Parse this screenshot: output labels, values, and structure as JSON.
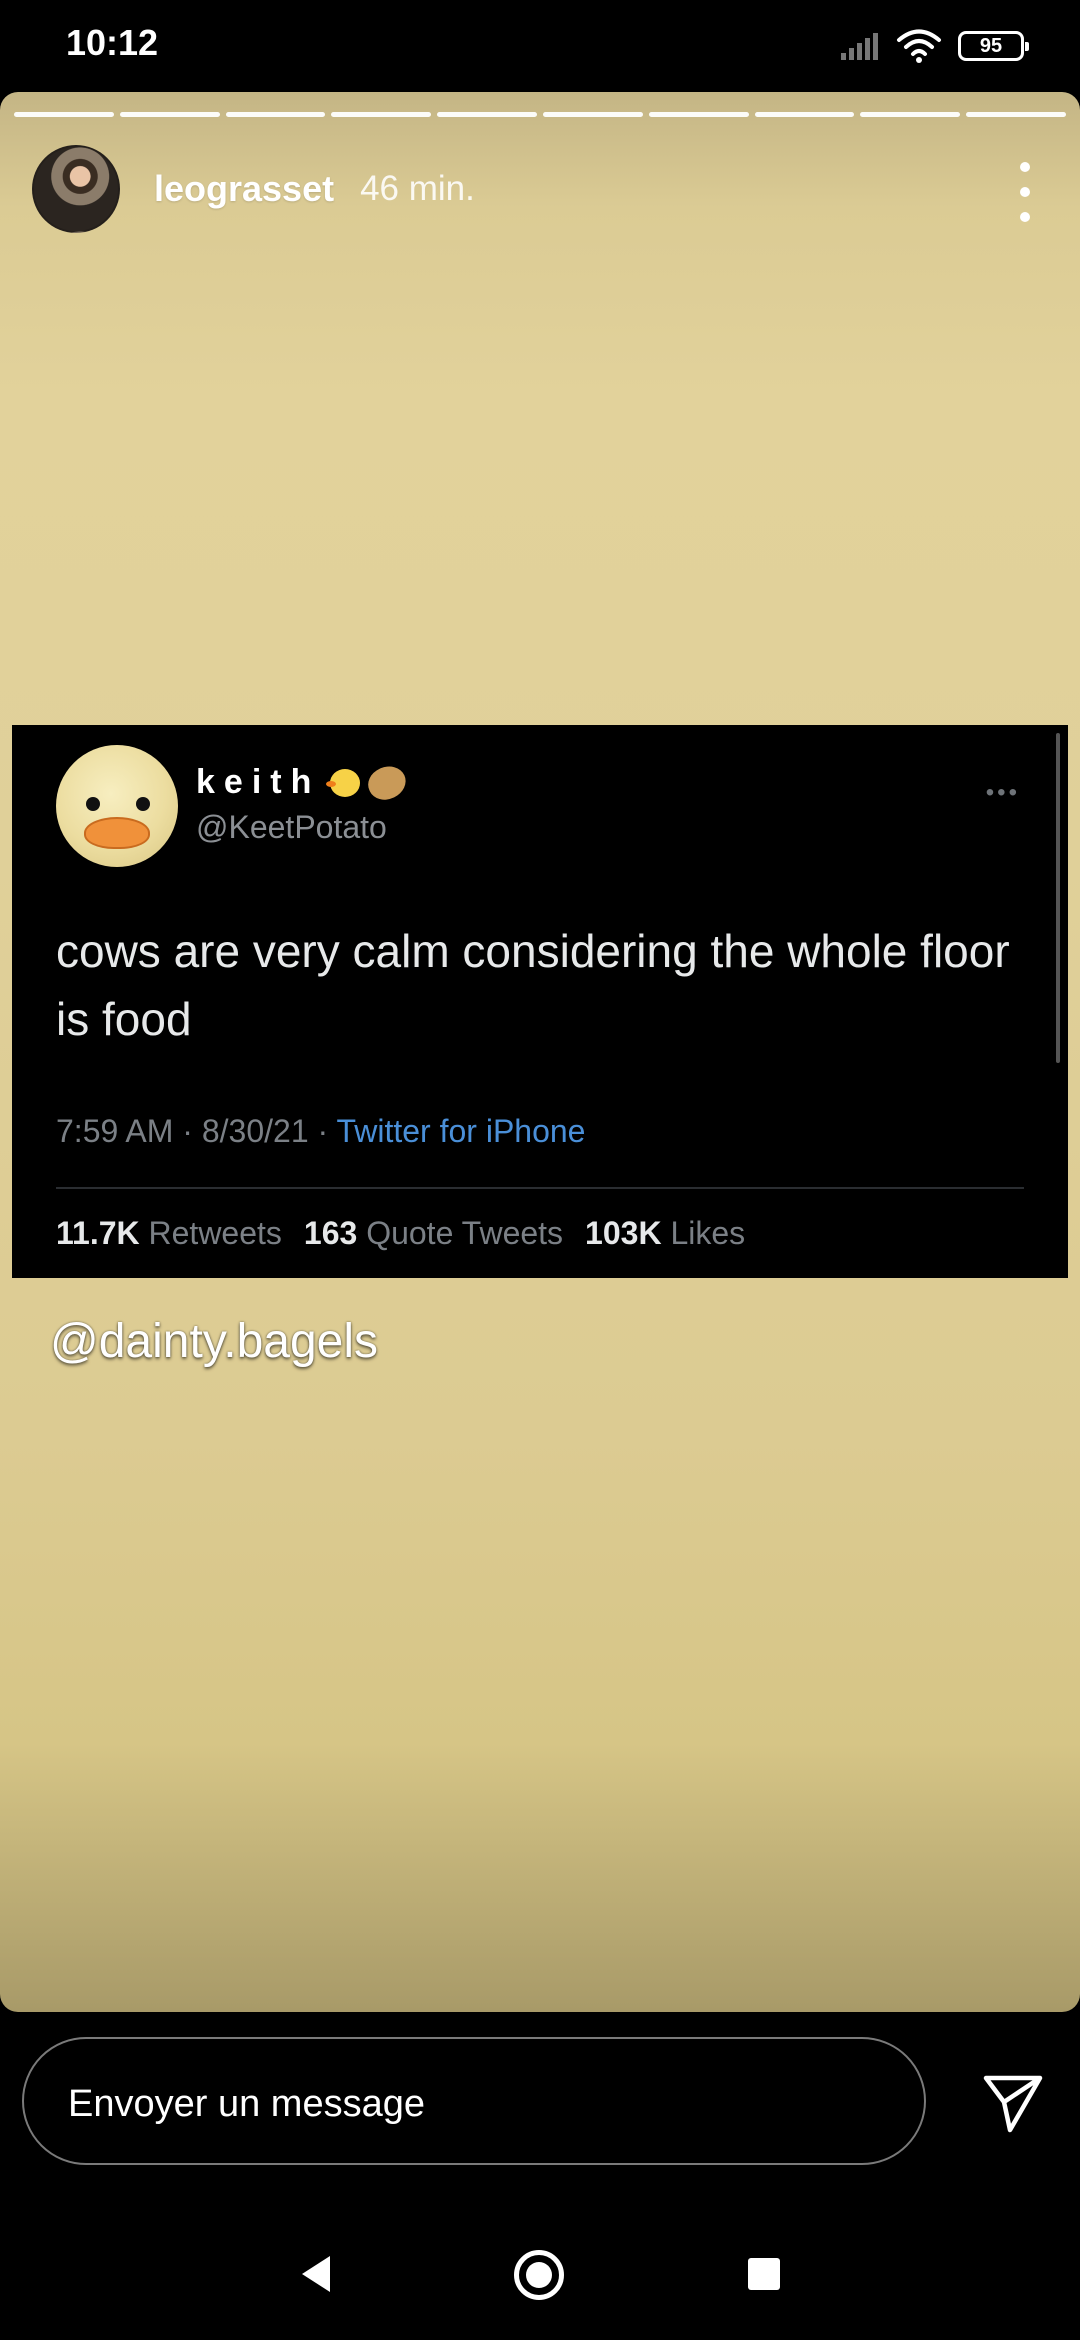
{
  "status_bar": {
    "time": "10:12",
    "battery": "95",
    "icons": [
      "signal-icon",
      "wifi-icon",
      "battery-icon"
    ]
  },
  "story": {
    "progress": {
      "segments": 10,
      "current": 10
    },
    "username": "leograsset",
    "time_ago": "46 min.",
    "more_icon": "vertical-dots-icon",
    "background_color": "#e0d099",
    "tweet": {
      "display_name": "keith",
      "name_emojis": [
        "chick-emoji",
        "potato-emoji"
      ],
      "handle": "@KeetPotato",
      "text": "cows are very calm considering the whole floor is food",
      "time": "7:59 AM",
      "date": "8/30/21",
      "source": "Twitter for iPhone",
      "retweets_count": "11.7K",
      "retweets_label": "Retweets",
      "quotes_count": "163",
      "quotes_label": "Quote Tweets",
      "likes_count": "103K",
      "likes_label": "Likes",
      "link_color": "#4a8fd8"
    },
    "mention": "@dainty.bagels"
  },
  "reply": {
    "placeholder": "Envoyer un message",
    "send_icon": "paper-plane-icon"
  },
  "nav_bar": {
    "icons": [
      "back-icon",
      "home-icon",
      "recents-icon"
    ]
  }
}
